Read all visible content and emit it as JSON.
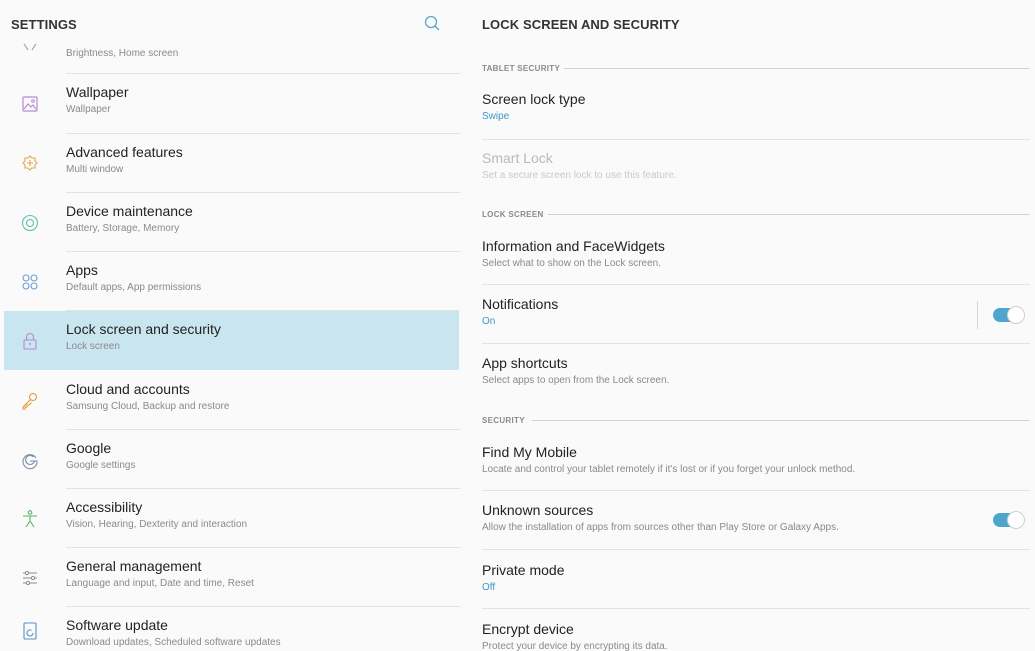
{
  "left": {
    "title": "SETTINGS",
    "items": [
      {
        "title": "",
        "subtitle": "Brightness, Home screen",
        "icon": "display-icon"
      },
      {
        "title": "Wallpaper",
        "subtitle": "Wallpaper",
        "icon": "wallpaper-icon"
      },
      {
        "title": "Advanced features",
        "subtitle": "Multi window",
        "icon": "advanced-features-icon"
      },
      {
        "title": "Device maintenance",
        "subtitle": "Battery, Storage, Memory",
        "icon": "device-maintenance-icon"
      },
      {
        "title": "Apps",
        "subtitle": "Default apps, App permissions",
        "icon": "apps-icon"
      },
      {
        "title": "Lock screen and security",
        "subtitle": "Lock screen",
        "icon": "lock-icon",
        "selected": true
      },
      {
        "title": "Cloud and accounts",
        "subtitle": "Samsung Cloud, Backup and restore",
        "icon": "key-icon"
      },
      {
        "title": "Google",
        "subtitle": "Google settings",
        "icon": "google-icon"
      },
      {
        "title": "Accessibility",
        "subtitle": "Vision, Hearing, Dexterity and interaction",
        "icon": "accessibility-icon"
      },
      {
        "title": "General management",
        "subtitle": "Language and input, Date and time, Reset",
        "icon": "sliders-icon"
      },
      {
        "title": "Software update",
        "subtitle": "Download updates, Scheduled software updates",
        "icon": "software-update-icon"
      }
    ]
  },
  "right": {
    "title": "LOCK SCREEN AND SECURITY",
    "sections": {
      "tablet_security": "TABLET SECURITY",
      "lock_screen": "LOCK SCREEN",
      "security": "SECURITY"
    },
    "items": {
      "screen_lock_type": {
        "title": "Screen lock type",
        "subtitle": "Swipe"
      },
      "smart_lock": {
        "title": "Smart Lock",
        "subtitle": "Set a secure screen lock to use this feature."
      },
      "face_widgets": {
        "title": "Information and FaceWidgets",
        "subtitle": "Select what to show on the Lock screen."
      },
      "notifications": {
        "title": "Notifications",
        "subtitle": "On",
        "toggle": true
      },
      "app_shortcuts": {
        "title": "App shortcuts",
        "subtitle": "Select apps to open from the Lock screen."
      },
      "find_my_mobile": {
        "title": "Find My Mobile",
        "subtitle": "Locate and control your tablet remotely if it's lost or if you forget your unlock method."
      },
      "unknown_sources": {
        "title": "Unknown sources",
        "subtitle": "Allow the installation of apps from sources other than Play Store or Galaxy Apps.",
        "toggle": true
      },
      "private_mode": {
        "title": "Private mode",
        "subtitle": "Off"
      },
      "encrypt_device": {
        "title": "Encrypt device",
        "subtitle": "Protect your device by encrypting its data."
      }
    }
  },
  "colors": {
    "selected_bg": "#c9e5ef",
    "accent": "#4ea6cf",
    "link_blue": "#3e96c6",
    "icon": "#9a8fb0"
  }
}
